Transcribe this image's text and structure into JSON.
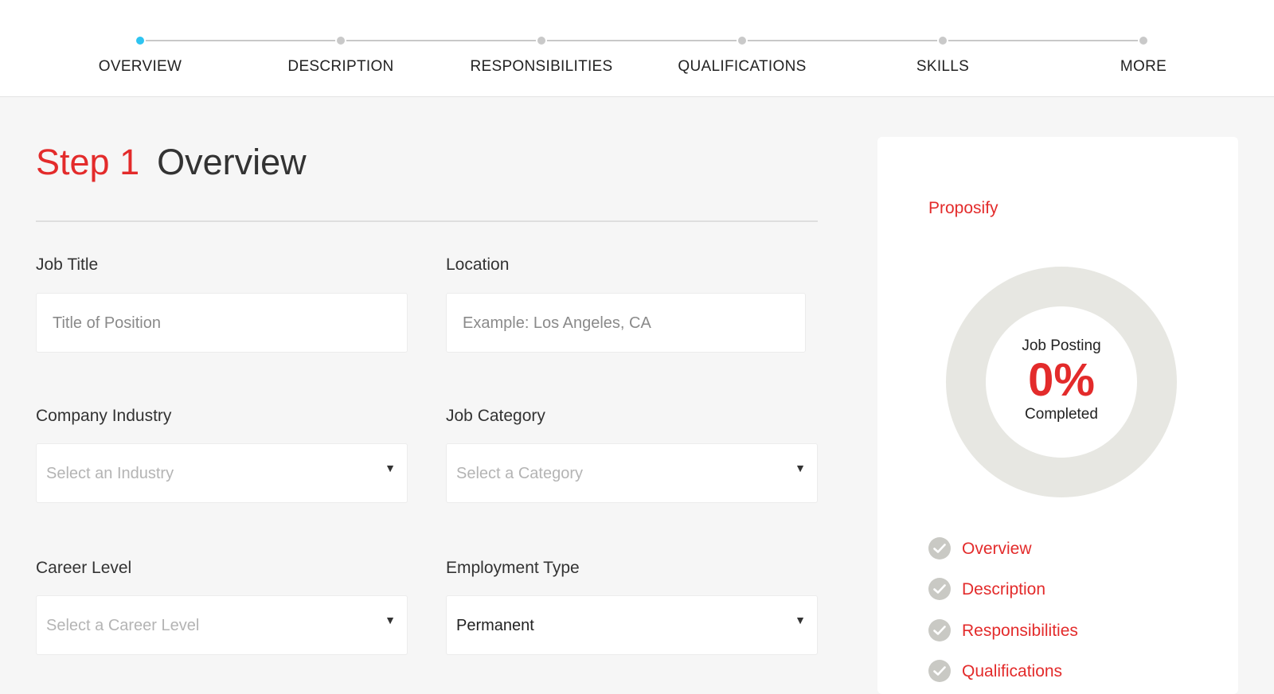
{
  "stepper": {
    "steps": [
      {
        "label": "OVERVIEW",
        "active": true
      },
      {
        "label": "DESCRIPTION",
        "active": false
      },
      {
        "label": "RESPONSIBILITIES",
        "active": false
      },
      {
        "label": "QUALIFICATIONS",
        "active": false
      },
      {
        "label": "SKILLS",
        "active": false
      },
      {
        "label": "MORE",
        "active": false
      }
    ],
    "active_color": "#2ec4f1",
    "inactive_color": "#c9c9c9"
  },
  "heading": {
    "step_number": "Step 1",
    "title": "Overview"
  },
  "form": {
    "job_title": {
      "label": "Job Title",
      "placeholder": "Title of Position"
    },
    "location": {
      "label": "Location",
      "placeholder": "Example: Los Angeles, CA"
    },
    "company_industry": {
      "label": "Company Industry",
      "placeholder": "Select an Industry"
    },
    "job_category": {
      "label": "Job Category",
      "placeholder": "Select a Category"
    },
    "career_level": {
      "label": "Career Level",
      "placeholder": "Select a Career Level"
    },
    "employment_type": {
      "label": "Employment Type",
      "value": "Permanent"
    }
  },
  "panel": {
    "brand": "Proposify",
    "progress": {
      "caption_top": "Job Posting",
      "percent_text": "0%",
      "percent_value": 0,
      "caption_bottom": "Completed"
    },
    "checklist": [
      {
        "label": "Overview"
      },
      {
        "label": "Description"
      },
      {
        "label": "Responsibilities"
      },
      {
        "label": "Qualifications"
      }
    ]
  },
  "colors": {
    "accent": "#e32b2b",
    "background": "#f6f6f6",
    "donut_track": "#e7e7e2"
  },
  "icons": {
    "dropdown": "caret-down-icon",
    "check": "check-circle-icon"
  }
}
